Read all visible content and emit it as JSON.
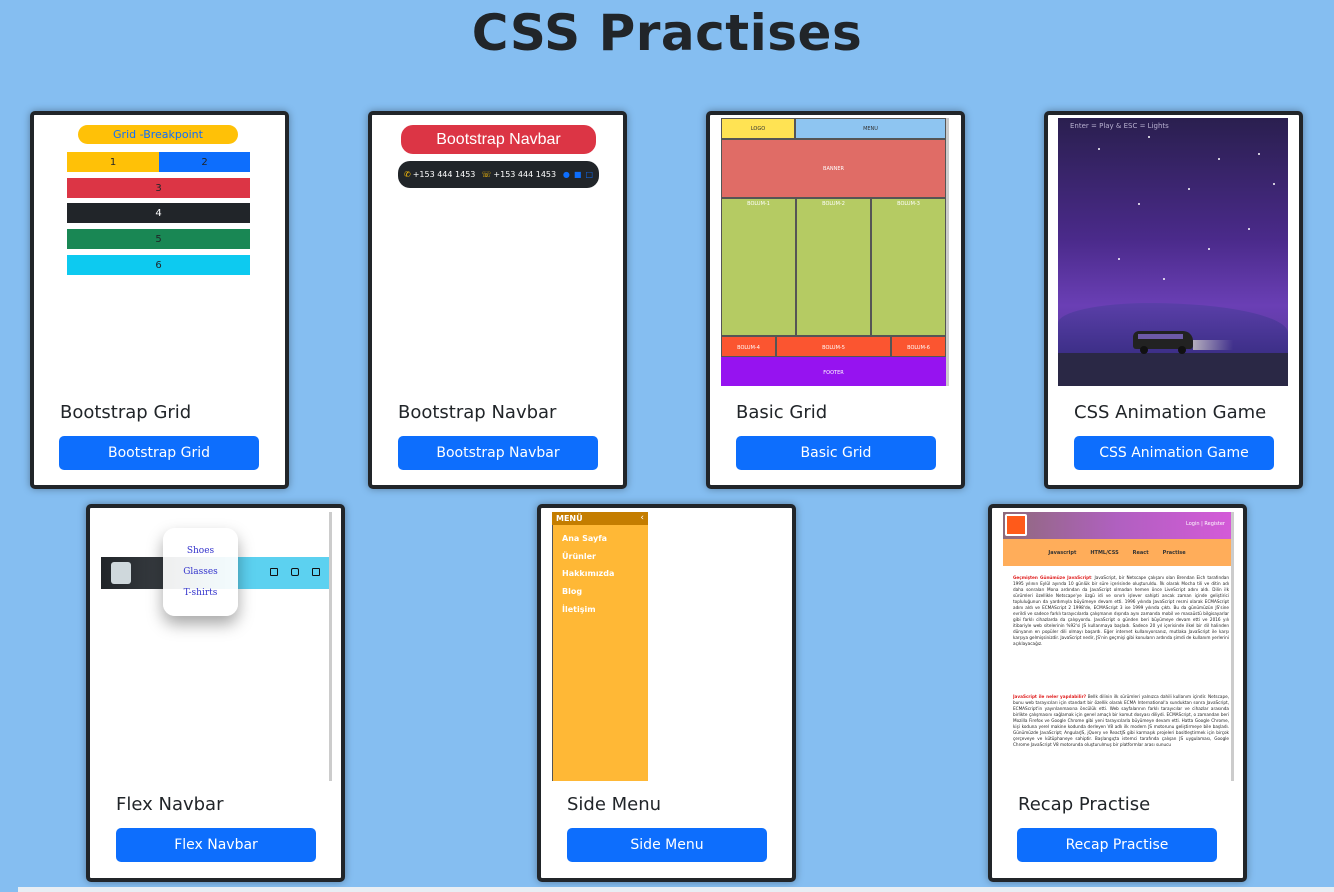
{
  "page": {
    "title": "CSS Practises"
  },
  "cards": [
    {
      "title": "Bootstrap Grid",
      "button": "Bootstrap Grid"
    },
    {
      "title": "Bootstrap Navbar",
      "button": "Bootstrap Navbar"
    },
    {
      "title": "Basic Grid",
      "button": "Basic Grid"
    },
    {
      "title": "CSS Animation Game",
      "button": "CSS Animation Game"
    },
    {
      "title": "Flex Navbar",
      "button": "Flex Navbar"
    },
    {
      "title": "Side Menu",
      "button": "Side Menu"
    },
    {
      "title": "Recap Practise",
      "button": "Recap Practise"
    }
  ],
  "thumbs": {
    "bootstrap_grid": {
      "header": "Grid -Breakpoint",
      "cells": [
        "1",
        "2",
        "3",
        "4",
        "5",
        "6"
      ]
    },
    "bootstrap_navbar": {
      "banner": "Bootstrap Navbar",
      "phone1": "+153 444 1453",
      "phone2": "+153 444 1453"
    },
    "basic_grid": {
      "logo": "LOGO",
      "menu": "MENU",
      "banner": "BANNER",
      "bolum1": "BOLUM-1",
      "bolum2": "BOLUM-2",
      "bolum3": "BOLUM-3",
      "bolum4": "BOLUM-4",
      "bolum5": "BOLUM-5",
      "bolum6": "BOLUM-6",
      "footer": "FOOTER"
    },
    "animation_game": {
      "hint": "Enter = Play & ESC = Lights"
    },
    "flex_navbar": {
      "items": [
        "Shoes",
        "Glasses",
        "T-shirts"
      ]
    },
    "side_menu": {
      "header": "MENÜ",
      "items": [
        "Ana Sayfa",
        "Ürünler",
        "Hakkımızda",
        "Blog",
        "İletişim"
      ]
    },
    "recap": {
      "login": "Login | Register",
      "nav": [
        "Javascript",
        "HTML/CSS",
        "React",
        "Practise"
      ],
      "heading1": "Geçmişten Günümüze JavaScript",
      "para1": ": JavaScript, bir Netscape çalışanı olan Brendan Eich tarafından 1995 yılının Eylül ayında 10 günlük bir süre içerisinde oluşturuldu. İlk olarak Mocha tili ve ditin adı daha sonraları Mona ardından da JavaScript olmadan hemen önce LiveScript adını aldı. Dilin ilk sürümleri özellikle Netscape'ye özgü idi ve sınırlı işlever sahipti ancak zaman içinde geliştirici topluluğunun da yardımıyla büyümeye devam etti. 1996 yılında JavaScript resmi olarak ECMAScript adını aldı ve ECMAScript 2 1998'de, ECMAScript 3 ise 1999 yılında çıktı. Bu da günümüzün JS'sine evrildi ve sadece farklı tarayıcılarda çalışmanın dışında aynı zamanda mobil ve masaüstü bilgisayarlar gibi farklı cihazlarda da çalışıyordu. JavaScript o günden beri büyümeye devam etti ve 2016 yılı itibariyle web sitelerinin %92'si JS kullanmaya başladı. Sadece 20 yıl içerisinde ilkel bir dil halinden dünyanın en popüler dili olmayı başardı. Eğer internet kullanıyorsanız, mutlaka JavaScript ile karşı karşıya gelmişsinizdir. JavaScript nedir, JS'nin geçmişi gibi konuların ardında şimdi de kullanım yerlerini açıklayacağız.",
      "heading2": "JavaScript ile neler yapılabilir?",
      "para2": " Bellk dilinin ilk sürümleri yalnızca dahili kullanım içindir. Netscape, bunu web tarayıcıları için standart bir özellik olarak ECMA International'a sunduktan sonra JavaScript, ECMAScript'in yayınlanmasına öncülük etti. Web sayfalarının farklı tarayıcılar ve cihazlar arasında birlikte çalışmasını sağlamak için genel amaçlı bir komut dosyası diliydi. ECMAScript, o zamandan beri Mozilla Firefox ve Google Chrome gibi yeni tarayıcılarla büyümeye devam etti. Hatta Google Chrome, kişi koduna yerel makine kodunda derleyen V8 adlı ilk modern JS motorunu geliştirmeye bile başladı. Günümüzde JavaScript; AngularJS, jQuery ve ReactJS gibi karmaşık projeleri basitleştirmek için birçok çerçeveye ve kütüphaneye sahiptir. Başlangıçta istemci tarafında çalışan JS uygulaması, Google Chrome JavaScript V8 motorunda oluşturulmuş bir platformlar arası sunucu"
    }
  },
  "colors": {
    "background": "#85bef1",
    "button": "#0d6efd"
  }
}
